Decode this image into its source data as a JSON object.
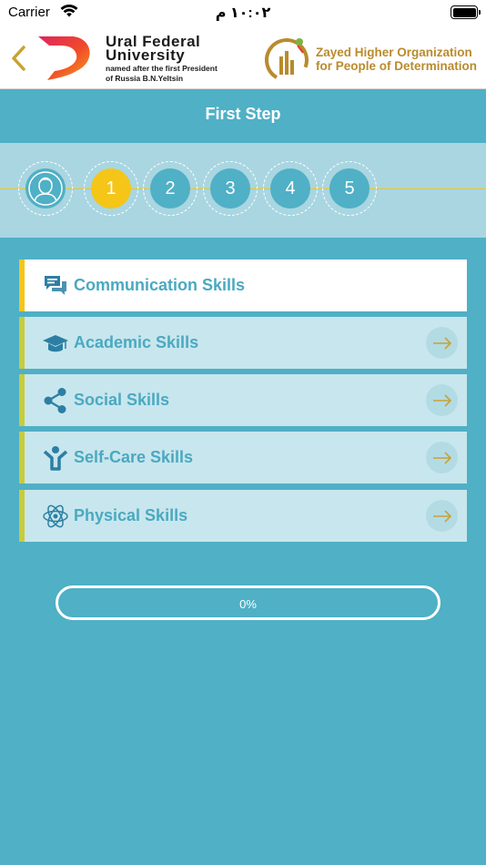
{
  "status_bar": {
    "carrier": "Carrier",
    "time": "١٠:٠٢ م"
  },
  "header": {
    "urfu_title_line1": "Ural Federal",
    "urfu_title_line2": "University",
    "urfu_subtitle_line1": "named after the first President",
    "urfu_subtitle_line2": "of Russia B.N.Yeltsin",
    "zayed_line1": "Zayed Higher Organization",
    "zayed_line2": "for People of Determination"
  },
  "page_title": "First Step",
  "stepper": {
    "steps": [
      "1",
      "2",
      "3",
      "4",
      "5"
    ],
    "active_step": "1"
  },
  "skills": [
    {
      "label": "Communication Skills",
      "icon": "chat-icon",
      "active": true
    },
    {
      "label": "Academic Skills",
      "icon": "graduation-cap-icon",
      "active": false
    },
    {
      "label": "Social Skills",
      "icon": "share-icon",
      "active": false
    },
    {
      "label": "Self-Care Skills",
      "icon": "person-raise-icon",
      "active": false
    },
    {
      "label": "Physical Skills",
      "icon": "atom-icon",
      "active": false
    }
  ],
  "progress": {
    "value": 0,
    "label": "0%"
  },
  "colors": {
    "background": "#4fb0c6",
    "accent_yellow": "#f5c518",
    "stepper_band": "#a9d6e1",
    "skill_row": "#c8e6ed",
    "skill_text": "#4aa9c1",
    "arrow": "#c9a233",
    "zayed_gold": "#b98b2d"
  }
}
